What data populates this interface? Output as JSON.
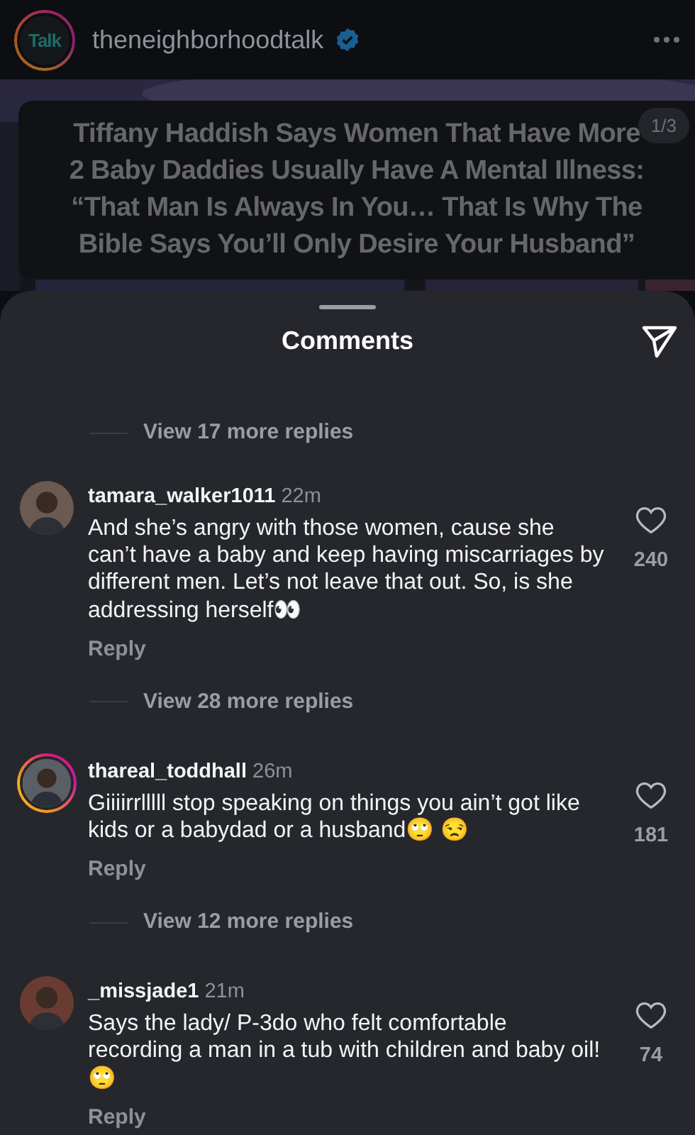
{
  "post": {
    "username": "theneighborhoodtalk",
    "verified": true,
    "avatar_text": "Talk",
    "story_ring": true,
    "media": {
      "kind": "picture",
      "headline": [
        "Tiffany Haddish Says Women That Have More",
        "2 Baby Daddies Usually Have A Mental Illness:",
        "“That Man Is Always In You…  That Is Why The",
        "Bible Says You’ll Only Desire Your Husband”"
      ],
      "counter": "1/3"
    }
  },
  "sheet": {
    "title": "Comments"
  },
  "previous": {
    "view_replies": "View 17 more replies"
  },
  "comments": [
    {
      "username": "tamara_walker1011",
      "time": "22m",
      "text": "And she’s angry with those women, cause she can’t have a baby and keep having miscarriages by different men. Let’s not leave that out. So, is she addressing herself👀",
      "likes": "240",
      "liked": false,
      "story_ring": false,
      "reply": "Reply",
      "view_replies": "View 28 more replies"
    },
    {
      "username": "thareal_toddhall",
      "time": "26m",
      "text": "Giiiirrlllll stop speaking on things you ain’t got like kids or a babydad or a husband🙄 😒",
      "likes": "181",
      "liked": false,
      "story_ring": true,
      "reply": "Reply",
      "view_replies": "View 12 more replies"
    },
    {
      "username": "_missjade1",
      "time": "21m",
      "text": "Says the lady/ P-3do who felt comfortable recording a man in a tub with children and baby oil! 🙄",
      "likes": "74",
      "liked": false,
      "story_ring": false,
      "reply": "Reply"
    }
  ]
}
